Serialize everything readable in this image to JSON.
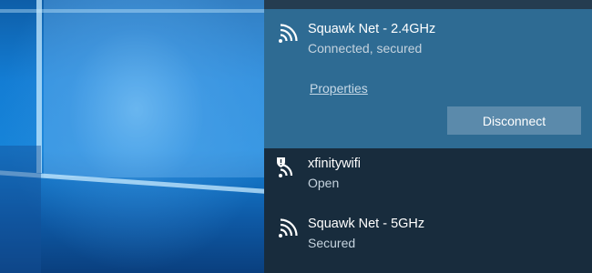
{
  "networks": [
    {
      "ssid": "Squawk Net - 2.4GHz",
      "status": "Connected, secured",
      "properties_label": "Properties",
      "action_label": "Disconnect",
      "icon": "wifi-icon"
    },
    {
      "ssid": "xfinitywifi",
      "status": "Open",
      "icon": "wifi-open-warning-icon"
    },
    {
      "ssid": "Squawk Net - 5GHz",
      "status": "Secured",
      "icon": "wifi-icon"
    }
  ],
  "colors": {
    "panel_background": "#192d3e",
    "selected_background": "#2e6b93",
    "button_background": "#5b8aab",
    "desktop_accent": "#1784d9"
  }
}
